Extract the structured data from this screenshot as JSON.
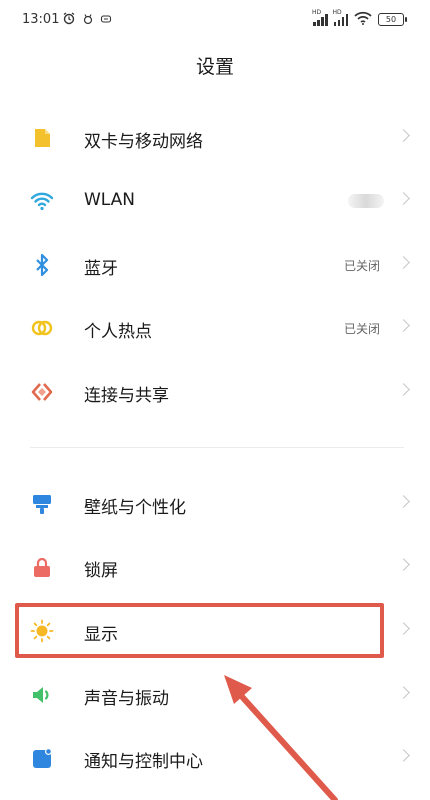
{
  "status_bar": {
    "time": "13:01",
    "battery": "50"
  },
  "header": {
    "title": "设置"
  },
  "settings": {
    "items": [
      {
        "label": "双卡与移动网络",
        "value": ""
      },
      {
        "label": "WLAN",
        "value": ""
      },
      {
        "label": "蓝牙",
        "value": "已关闭"
      },
      {
        "label": "个人热点",
        "value": "已关闭"
      },
      {
        "label": "连接与共享",
        "value": ""
      },
      {
        "label": "壁纸与个性化",
        "value": ""
      },
      {
        "label": "锁屏",
        "value": ""
      },
      {
        "label": "显示",
        "value": ""
      },
      {
        "label": "声音与振动",
        "value": ""
      },
      {
        "label": "通知与控制中心",
        "value": ""
      }
    ]
  },
  "colors": {
    "sim": "#f3c12b",
    "wlan": "#2fa7df",
    "bluetooth": "#2f8fe0",
    "hotspot": "#f2c21d",
    "share": "#e0694e",
    "wallpaper": "#2f86df",
    "lock": "#ec6b62",
    "display": "#f7b825",
    "sound": "#43c06a",
    "notify": "#2f86df",
    "annotation": "#e05a4b"
  }
}
